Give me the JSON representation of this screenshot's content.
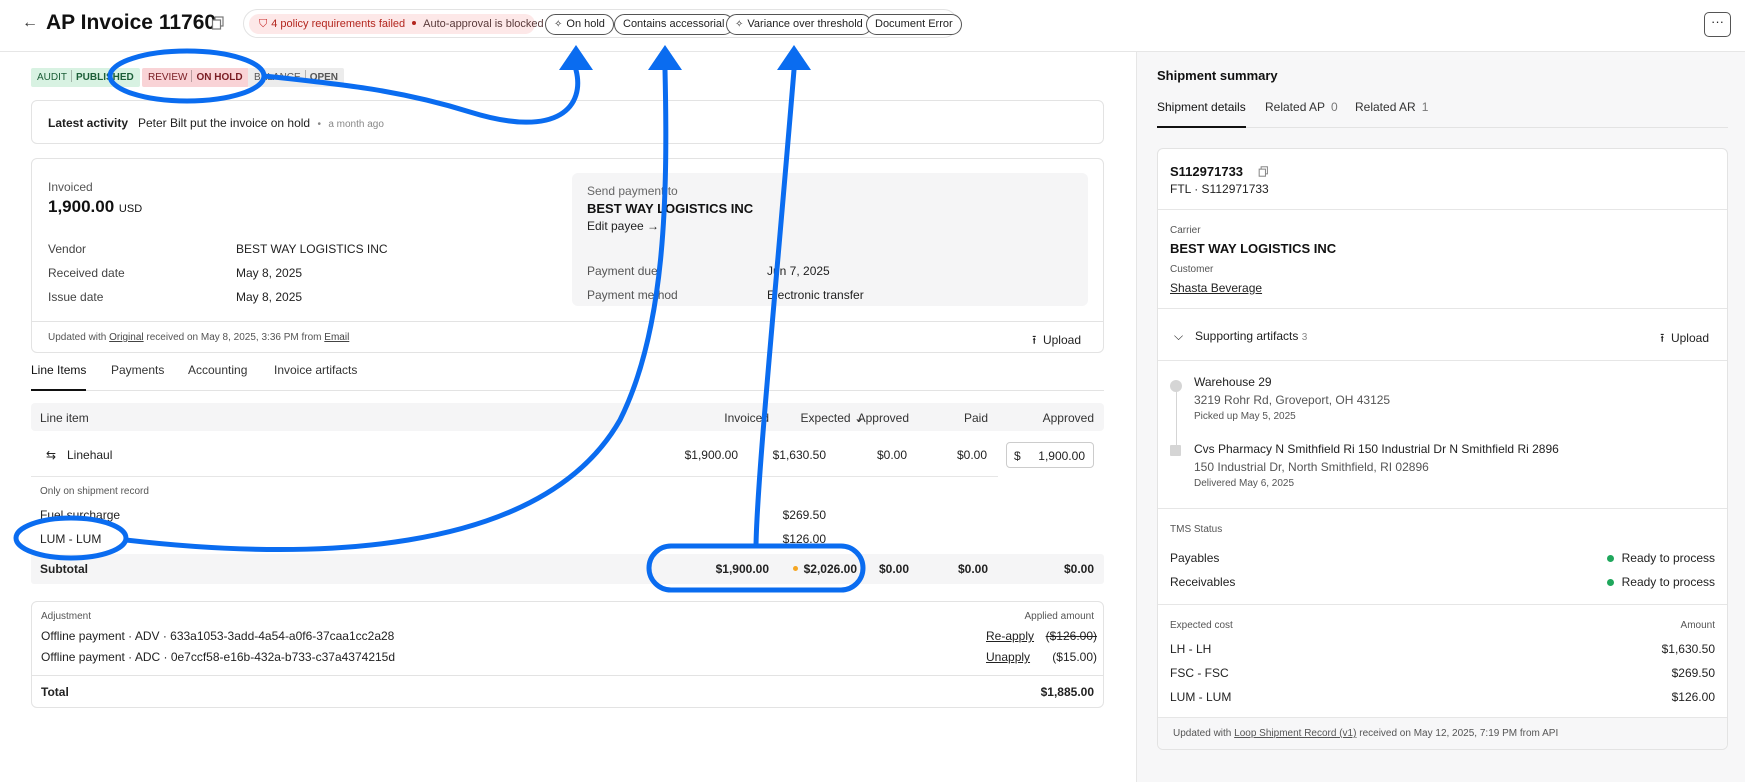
{
  "header": {
    "back_icon": "arrow-left-icon",
    "title": "AP Invoice 11760",
    "policy_failed": "4 policy requirements failed",
    "policy_blocked": "Auto-approval is blocked",
    "chips": [
      "On hold",
      "Contains accessorial",
      "Variance over threshold",
      "Document Error"
    ],
    "more_label": "···"
  },
  "badges": {
    "audit_key": "AUDIT",
    "audit_val": "PUBLISHED",
    "review_key": "REVIEW",
    "review_val": "ON HOLD",
    "balance_key": "BALANCE",
    "balance_val": "OPEN"
  },
  "activity": {
    "label": "Latest activity",
    "text": "Peter Bilt put the invoice on hold",
    "sep": "•",
    "ago": "a month ago"
  },
  "invoice": {
    "invoiced_label": "Invoiced",
    "amount": "1,900.00",
    "currency": "USD",
    "vendor_label": "Vendor",
    "vendor": "BEST WAY LOGISTICS INC",
    "received_label": "Received date",
    "received": "May 8, 2025",
    "issue_label": "Issue date",
    "issue": "May 8, 2025",
    "payto_label": "Send payment to",
    "payto_name": "BEST WAY LOGISTICS INC",
    "edit_payee": "Edit payee →",
    "due_label": "Payment due",
    "due": "Jun 7, 2025",
    "method_label": "Payment method",
    "method": "Electronic transfer",
    "footer_prefix": "Updated with",
    "footer_link": "Original",
    "footer_mid": "received on May 8, 2025, 3:36 PM from",
    "footer_src": "Email",
    "upload": "Upload"
  },
  "tabs": [
    "Line Items",
    "Payments",
    "Accounting",
    "Invoice artifacts"
  ],
  "line_table": {
    "headers": [
      "Line item",
      "Invoiced",
      "Expected",
      "Approved",
      "Paid",
      "Approved"
    ],
    "linehaul": {
      "name": "Linehaul",
      "invoiced": "$1,900.00",
      "expected": "$1,630.50",
      "approved": "$0.00",
      "paid": "$0.00",
      "approved_currency": "$",
      "approved_input": "1,900.00"
    },
    "only_label": "Only on shipment record",
    "fuel": {
      "name": "Fuel surcharge",
      "expected": "$269.50"
    },
    "lum": {
      "name": "LUM - LUM",
      "expected": "$126.00"
    },
    "subtotal": {
      "label": "Subtotal",
      "invoiced": "$1,900.00",
      "expected": "$2,026.00",
      "approved": "$0.00",
      "paid": "$0.00",
      "approved2": "$0.00"
    }
  },
  "adjustments": {
    "header_key": "Adjustment",
    "header_amount": "Applied amount",
    "rows": [
      {
        "text": "Offline payment · ADV · 633a1053-3add-4a54-a0f6-37caa1cc2a28",
        "action": "Re-apply",
        "amount": "($126.00)"
      },
      {
        "text": "Offline payment · ADC · 0e7ccf58-e16b-432a-b733-c37a4374215d",
        "action": "Unapply",
        "amount": "($15.00)"
      }
    ],
    "total_label": "Total",
    "total": "$1,885.00"
  },
  "shipment": {
    "title": "Shipment summary",
    "tabs": [
      {
        "label": "Shipment details",
        "count": ""
      },
      {
        "label": "Related AP",
        "count": "0"
      },
      {
        "label": "Related AR",
        "count": "1"
      }
    ],
    "id": "S112971733",
    "mode": "FTL · S112971733",
    "carrier_label": "Carrier",
    "carrier": "BEST WAY LOGISTICS INC",
    "customer_label": "Customer",
    "customer": "Shasta Beverage",
    "artifacts_label": "Supporting artifacts",
    "artifacts_count": "3",
    "upload": "Upload",
    "stop1_name": "Warehouse 29",
    "stop1_addr": "3219 Rohr Rd, Groveport, OH 43125",
    "stop1_when": "Picked up May 5, 2025",
    "stop2_name": "Cvs Pharmacy N Smithfield Ri 150 Industrial Dr N Smithfield Ri 2896",
    "stop2_addr": "150 Industrial Dr, North Smithfield, RI 02896",
    "stop2_when": "Delivered May 6, 2025",
    "tms_label": "TMS Status",
    "payables_label": "Payables",
    "payables": "Ready to process",
    "receivables_label": "Receivables",
    "receivables": "Ready to process",
    "cost_label": "Expected cost",
    "amount_label": "Amount",
    "costs": [
      {
        "name": "LH - LH",
        "amount": "$1,630.50"
      },
      {
        "name": "FSC - FSC",
        "amount": "$269.50"
      },
      {
        "name": "LUM - LUM",
        "amount": "$126.00"
      }
    ],
    "footer_prefix": "Updated with",
    "footer_link": "Loop Shipment Record (v1)",
    "footer_rest": "received on May 12, 2025, 7:19 PM from API"
  },
  "colors": {
    "annotation": "#0a6cf0",
    "success": "#1fa75c",
    "danger": "#b3261e",
    "warning": "#f5a623"
  }
}
